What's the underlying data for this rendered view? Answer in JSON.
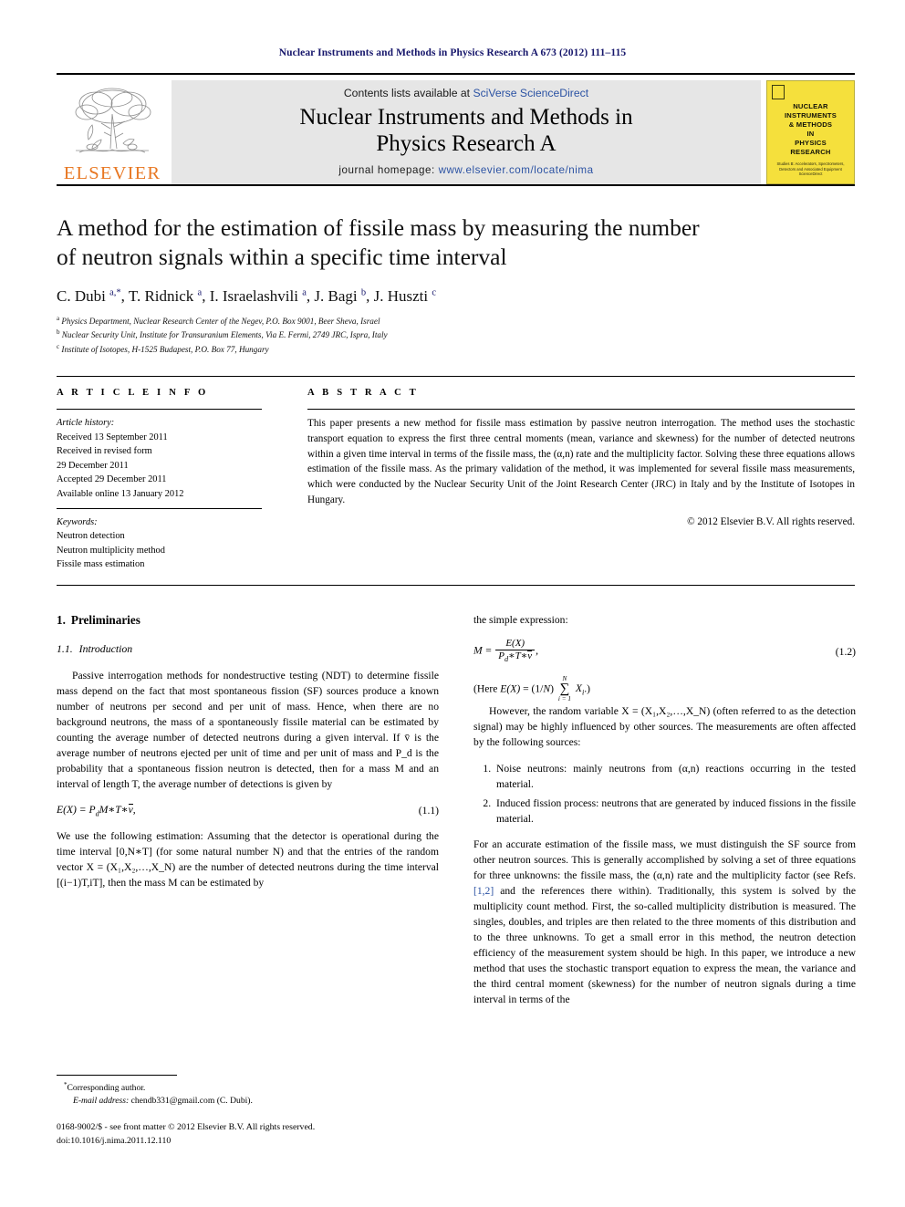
{
  "running_head": "Nuclear Instruments and Methods in Physics Research A 673 (2012) 111–115",
  "masthead": {
    "publisher_name": "ELSEVIER",
    "contents_prefix": "Contents lists available at ",
    "contents_link": "SciVerse ScienceDirect",
    "journal_title_line1": "Nuclear Instruments and Methods in",
    "journal_title_line2": "Physics Research A",
    "homepage_prefix": "journal homepage: ",
    "homepage_url": "www.elsevier.com/locate/nima",
    "cover": {
      "title_lines": [
        "NUCLEAR",
        "INSTRUMENTS",
        "& METHODS",
        "IN",
        "PHYSICS",
        "RESEARCH"
      ],
      "subtitle": "Studies B: Accelerators, Spectrometers, Detectors and Associated Equipment",
      "footer": "ScienceDirect"
    },
    "accent_link_color": "#2b52a3",
    "elsevier_orange": "#e87722",
    "cover_yellow": "#f5e03c"
  },
  "article": {
    "title_line1": "A method for the estimation of fissile mass by measuring the number",
    "title_line2": "of neutron signals within a specific time interval",
    "authors_html": "C. Dubi <sup>a,*</sup>, T. Ridnick <sup>a</sup>, I. Israelashvili <sup>a</sup>, J. Bagi <sup>b</sup>, J. Huszti <sup>c</sup>",
    "affiliations": [
      {
        "marker": "a",
        "text": "Physics Department, Nuclear Research Center of the Negev, P.O. Box 9001, Beer Sheva, Israel"
      },
      {
        "marker": "b",
        "text": "Nuclear Security Unit, Institute for Transuranium Elements, Via E. Fermi, 2749 JRC, Ispra, Italy"
      },
      {
        "marker": "c",
        "text": "Institute of Isotopes, H-1525 Budapest, P.O. Box 77, Hungary"
      }
    ]
  },
  "article_info": {
    "heading": "A R T I C L E   I N F O",
    "history_label": "Article history:",
    "history_lines": [
      "Received 13 September 2011",
      "Received in revised form",
      "29 December 2011",
      "Accepted 29 December 2011",
      "Available online 13 January 2012"
    ],
    "keywords_label": "Keywords:",
    "keywords": [
      "Neutron detection",
      "Neutron multiplicity method",
      "Fissile mass estimation"
    ]
  },
  "abstract": {
    "heading": "A B S T R A C T",
    "text": "This paper presents a new method for fissile mass estimation by passive neutron interrogation. The method uses the stochastic transport equation to express the first three central moments (mean, variance and skewness) for the number of detected neutrons within a given time interval in terms of the fissile mass, the (α,n) rate and the multiplicity factor. Solving these three equations allows estimation of the fissile mass. As the primary validation of the method, it was implemented for several fissile mass measurements, which were conducted by the Nuclear Security Unit of the Joint Research Center (JRC) in Italy and by the Institute of Isotopes in Hungary.",
    "copyright": "© 2012 Elsevier B.V. All rights reserved."
  },
  "body": {
    "section1_num": "1.",
    "section1_title": "Preliminaries",
    "subsection11_num": "1.1.",
    "subsection11_title": "Introduction",
    "left_para1": "Passive interrogation methods for nondestructive testing (NDT) to determine fissile mass depend on the fact that most spontaneous fission (SF) sources produce a known number of neutrons per second and per unit of mass. Hence, when there are no background neutrons, the mass of a spontaneously fissile material can be estimated by counting the average number of detected neutrons during a given interval. If v̄ is the average number of neutrons ejected per unit of time and per unit of mass and P_d is the probability that a spontaneous fission neutron is detected, then for a mass M and an interval of length T, the average number of detections is given by",
    "eq11_number": "(1.1)",
    "left_para2": "We use the following estimation: Assuming that the detector is operational during the time interval [0,N∗T] (for some natural number N) and that the entries of the random vector X = (X₁,X₂,…,X_N) are the number of detected neutrons during the time interval [(i−1)T,iT], then the mass M can be estimated by",
    "right_lead": "the simple expression:",
    "eq12_number": "(1.2)",
    "right_here_note": "(Here E(X) = (1/N) ∑ᴺᵢ₌₁ Xᵢ.)",
    "right_para1": "However, the random variable X = (X₁,X₂,…,X_N) (often referred to as the detection signal) may be highly influenced by other sources. The measurements are often affected by the following sources:",
    "numbered_items": [
      "Noise neutrons: mainly neutrons from (α,n) reactions occurring in the tested material.",
      "Induced fission process: neutrons that are generated by induced fissions in the fissile material."
    ],
    "right_para2_a": "For an accurate estimation of the fissile mass, we must distinguish the SF source from other neutron sources. This is generally accomplished by solving a set of three equations for three unknowns: the fissile mass, the (α,n) rate and the multiplicity factor (see Refs. ",
    "right_para2_ref": "[1,2]",
    "right_para2_b": " and the references there within). Traditionally, this system is solved by the multiplicity count method. First, the so-called multiplicity distribution is measured. The singles, doubles, and triples are then related to the three moments of this distribution and to the three unknowns. To get a small error in this method, the neutron detection efficiency of the measurement system should be high. In this paper, we introduce a new method that uses the stochastic transport equation to express the mean, the variance and the third central moment (skewness) for the number of neutron signals during a time interval in terms of the"
  },
  "footer": {
    "corresponding_marker": "*",
    "corresponding_label": "Corresponding author.",
    "email_label": "E-mail address:",
    "email_value": "chendb331@gmail.com (C. Dubi).",
    "issn_line": "0168-9002/$ - see front matter © 2012 Elsevier B.V. All rights reserved.",
    "doi_line": "doi:10.1016/j.nima.2011.12.110"
  }
}
